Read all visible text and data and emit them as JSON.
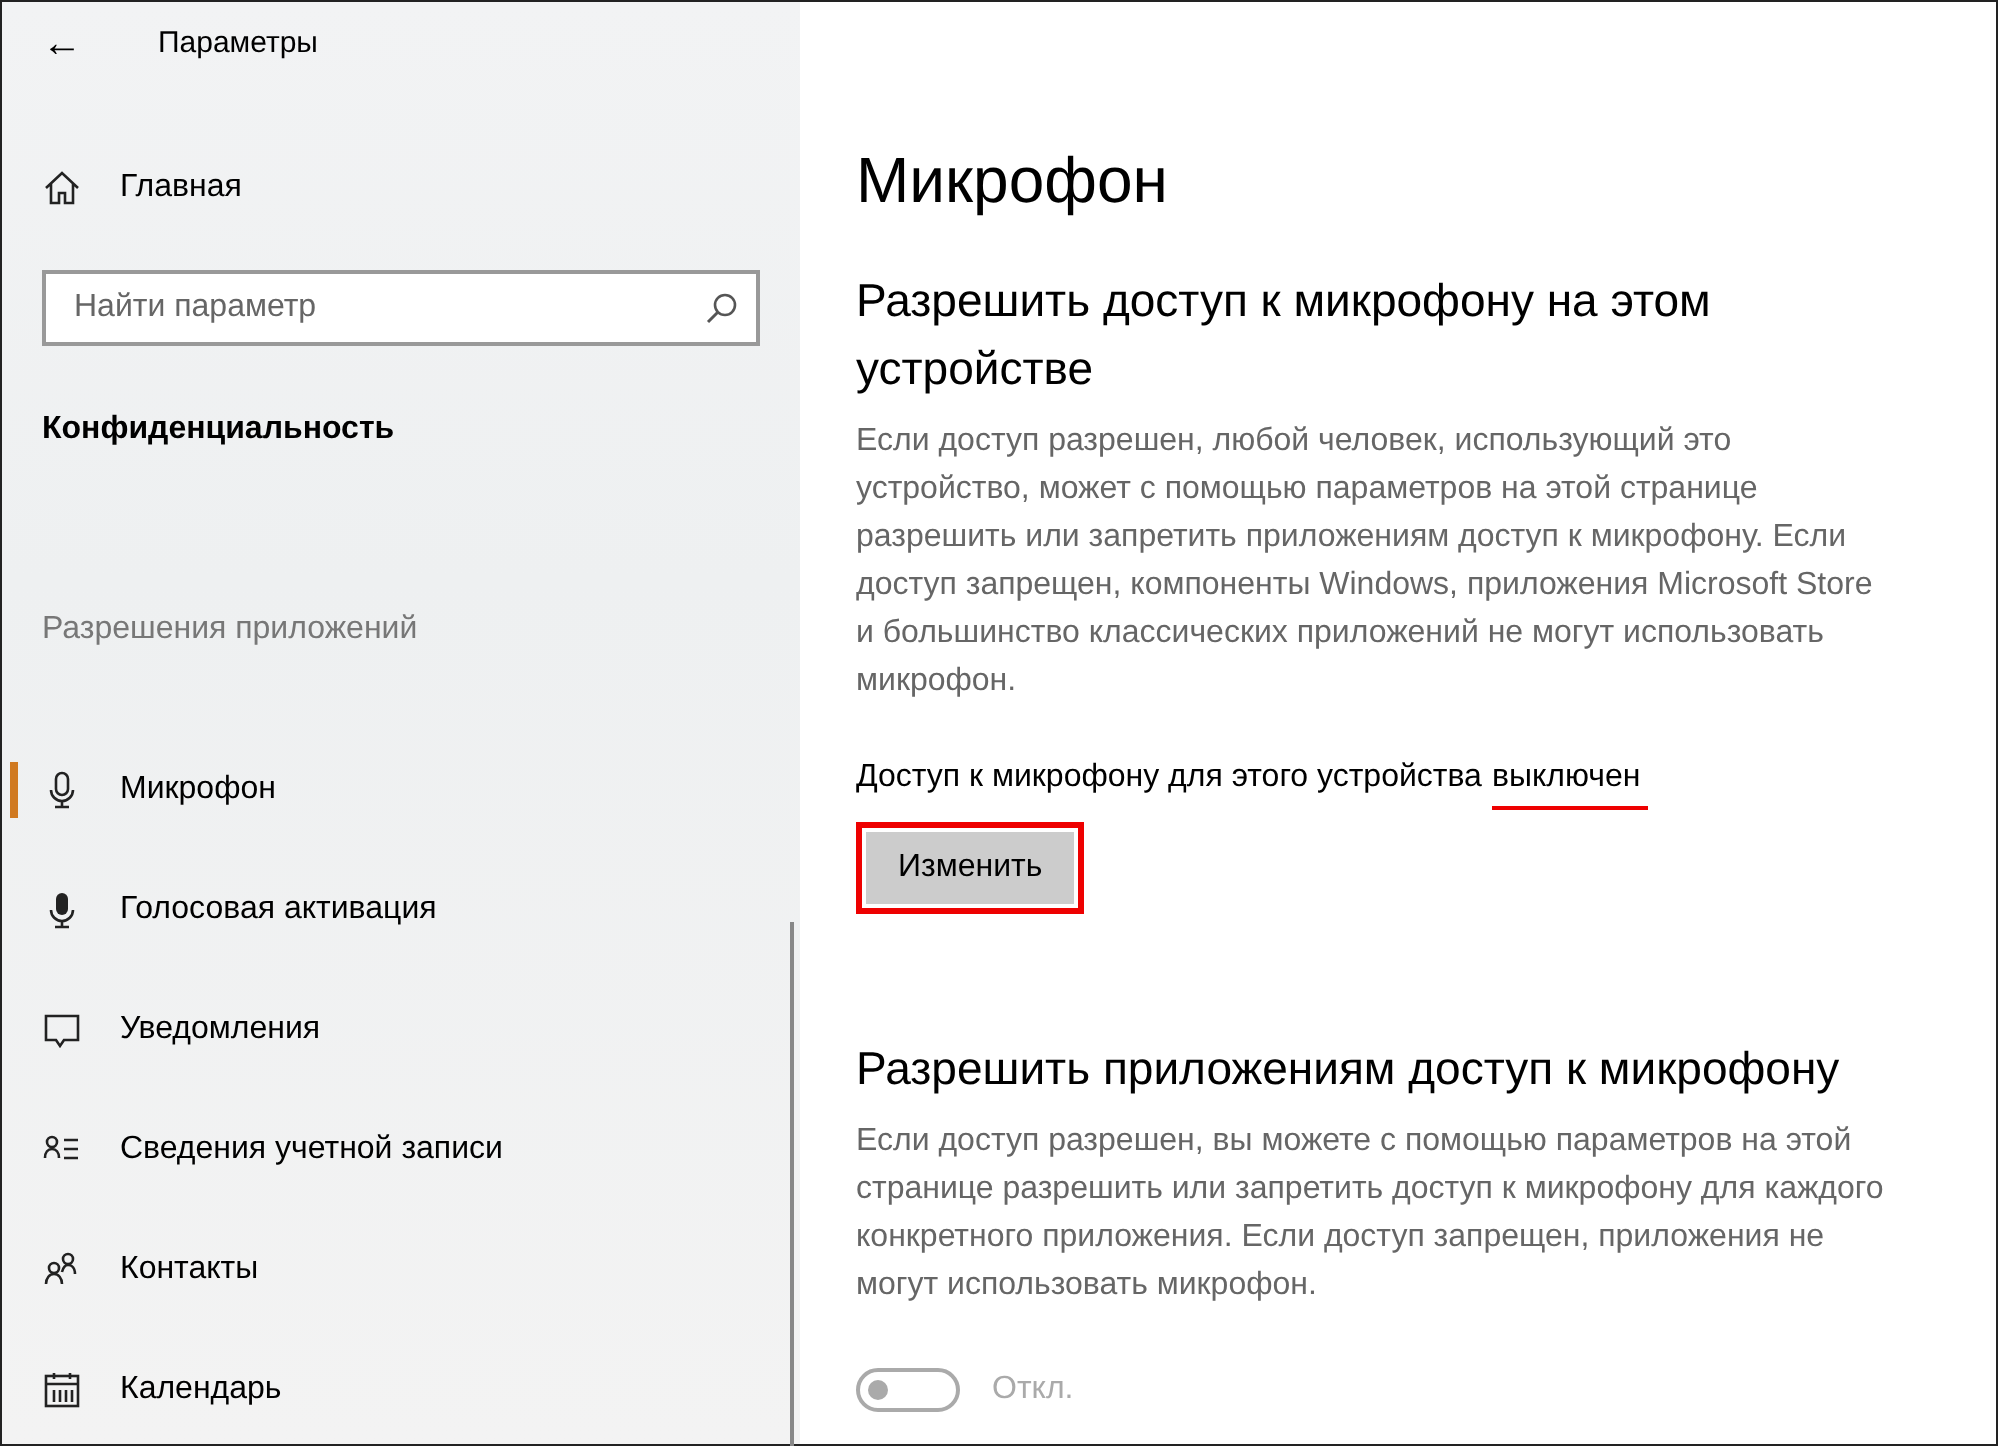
{
  "window": {
    "title": "Параметры",
    "back": "←"
  },
  "sidebar": {
    "home": "Главная",
    "search": {
      "placeholder": "Найти параметр"
    },
    "section": "Конфиденциальность",
    "group": "Разрешения приложений",
    "items": [
      {
        "label": "Микрофон",
        "kind": "mic",
        "selected": true
      },
      {
        "label": "Голосовая активация",
        "kind": "mic-solid",
        "selected": false
      },
      {
        "label": "Уведомления",
        "kind": "bubble",
        "selected": false
      },
      {
        "label": "Сведения учетной записи",
        "kind": "account",
        "selected": false
      },
      {
        "label": "Контакты",
        "kind": "people",
        "selected": false
      },
      {
        "label": "Календарь",
        "kind": "calendar",
        "selected": false
      }
    ]
  },
  "content": {
    "title": "Микрофон",
    "device_section": {
      "heading": "Разрешить доступ к микрофону на этом устройстве",
      "description": "Если доступ разрешен, любой человек, использующий это устройство, может с помощью параметров на этой странице разрешить или запретить приложениям доступ к микрофону. Если доступ запрещен, компоненты Windows, приложения Microsoft Store и большинство классических приложений не могут использовать микрофон.",
      "status_label": "Доступ к микрофону для этого устройства",
      "status_value": "выключен",
      "status_underlined": true,
      "button": {
        "label": "Изменить",
        "outlined": true
      }
    },
    "apps_section": {
      "heading": "Разрешить приложениям доступ к микрофону",
      "description": "Если доступ разрешен, вы можете с помощью параметров на этой странице разрешить или запретить доступ к микрофону для каждого конкретного приложения. Если доступ запрещен, приложения не могут использовать микрофон.",
      "toggle": {
        "on": false,
        "disabled": true,
        "label": "Откл."
      }
    }
  }
}
